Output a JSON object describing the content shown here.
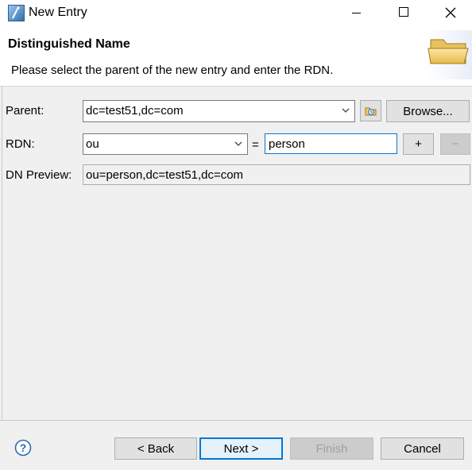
{
  "window": {
    "title": "New Entry",
    "icons": {
      "app": "wizard-wand-icon",
      "minimize": "minimize-icon",
      "maximize": "maximize-icon",
      "close": "close-icon"
    }
  },
  "header": {
    "title": "Distinguished Name",
    "description": "Please select the parent of the new entry and enter the RDN.",
    "icon": "folder-icon"
  },
  "form": {
    "parent_label": "Parent:",
    "parent_value": "dc=test51,dc=com",
    "browse_label": "Browse...",
    "rdn_label": "RDN:",
    "rdn_attribute": "ou",
    "equals": "=",
    "rdn_value": "person",
    "add_label": "+",
    "remove_label": "−",
    "dn_preview_label": "DN Preview:",
    "dn_preview_value": "ou=person,dc=test51,dc=com"
  },
  "footer": {
    "help_icon": "help-icon",
    "back_label": "< Back",
    "next_label": "Next >",
    "finish_label": "Finish",
    "cancel_label": "Cancel"
  },
  "colors": {
    "accent": "#0078d7",
    "panel": "#f0f0f0",
    "disabled_text": "#a0a0a0"
  }
}
